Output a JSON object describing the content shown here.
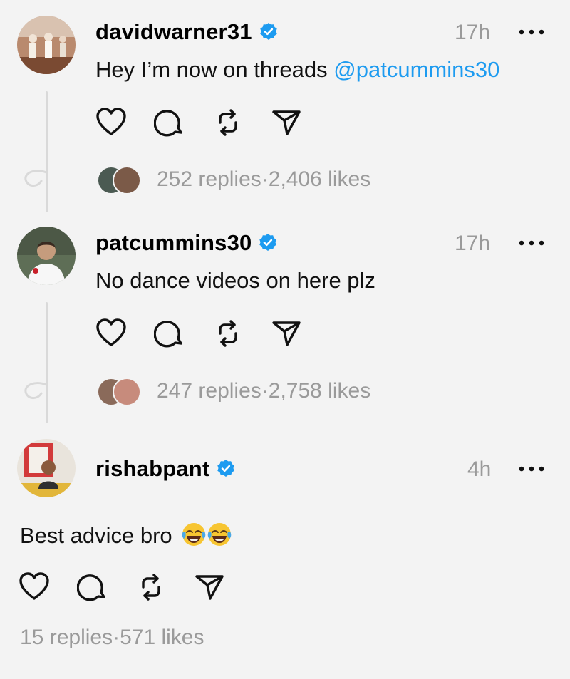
{
  "posts": [
    {
      "username": "davidwarner31",
      "time": "17h",
      "text": "Hey I’m now on threads ",
      "mention": "@patcummins30",
      "replies": "252 replies",
      "separator": " · ",
      "likes": "2,406 likes"
    },
    {
      "username": "patcummins30",
      "time": "17h",
      "text": "No dance videos on here plz",
      "replies": "247 replies",
      "separator": " · ",
      "likes": "2,758 likes"
    },
    {
      "username": "rishabpant",
      "time": "4h",
      "text": "Best advice bro",
      "emoji": "😂😂",
      "replies": "15 replies",
      "separator": " · ",
      "likes": "571 likes"
    }
  ],
  "icons": {
    "like": "heart-icon",
    "reply": "comment-bubble-icon",
    "repost": "repost-icon",
    "share": "send-icon",
    "more": "more-dots-icon",
    "verified": "verified-badge-icon"
  },
  "colors": {
    "background": "#f3f3f3",
    "mention": "#1d9bf0",
    "verified": "#1d9bf0",
    "muted": "#9a9a9a"
  }
}
